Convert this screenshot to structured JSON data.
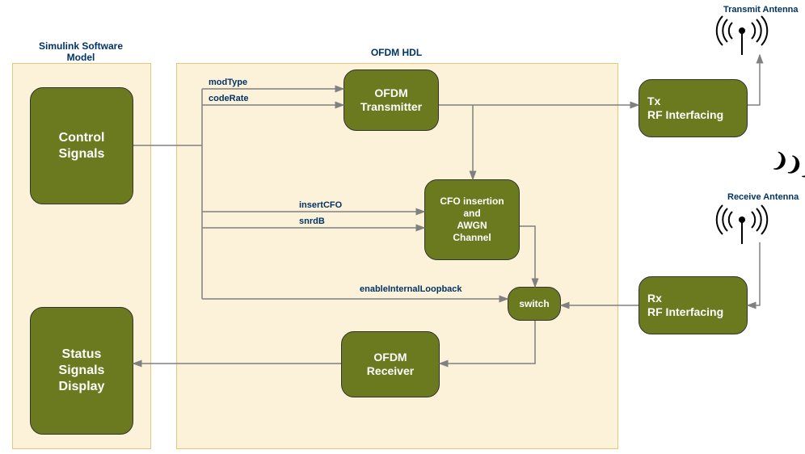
{
  "regions": {
    "simulink_label": "Simulink Software\nModel",
    "ofdm_hdl_label": "OFDM HDL"
  },
  "blocks": {
    "control_signals": "Control\nSignals",
    "status_display": "Status\nSignals\nDisplay",
    "ofdm_transmitter": "OFDM\nTransmitter",
    "cfo_awgn": "CFO insertion\nand\nAWGN\nChannel",
    "switch": "switch",
    "ofdm_receiver": "OFDM\nReceiver",
    "tx_rf": "Tx\nRF Interfacing",
    "rx_rf": "Rx\nRF Interfacing"
  },
  "signals": {
    "modType": "modType",
    "codeRate": "codeRate",
    "insertCFO": "insertCFO",
    "snrdB": "snrdB",
    "enableInternalLoopback": "enableInternalLoopback"
  },
  "antennas": {
    "transmit": "Transmit Antenna",
    "receive": "Receive Antenna"
  },
  "rf_waves": "❩❩❩",
  "chart_data": {
    "type": "block-diagram",
    "regions": [
      {
        "id": "simulink",
        "label": "Simulink Software Model",
        "contains": [
          "control_signals",
          "status_display"
        ]
      },
      {
        "id": "ofdm_hdl",
        "label": "OFDM HDL",
        "contains": [
          "ofdm_transmitter",
          "cfo_awgn",
          "switch",
          "ofdm_receiver"
        ]
      }
    ],
    "nodes": [
      {
        "id": "control_signals",
        "label": "Control Signals"
      },
      {
        "id": "status_display",
        "label": "Status Signals Display"
      },
      {
        "id": "ofdm_transmitter",
        "label": "OFDM Transmitter"
      },
      {
        "id": "cfo_awgn",
        "label": "CFO insertion and AWGN Channel"
      },
      {
        "id": "switch",
        "label": "switch"
      },
      {
        "id": "ofdm_receiver",
        "label": "OFDM Receiver"
      },
      {
        "id": "tx_rf",
        "label": "Tx RF Interfacing"
      },
      {
        "id": "rx_rf",
        "label": "Rx RF Interfacing"
      },
      {
        "id": "tx_antenna",
        "label": "Transmit Antenna"
      },
      {
        "id": "rx_antenna",
        "label": "Receive Antenna"
      }
    ],
    "edges": [
      {
        "from": "control_signals",
        "to": "ofdm_transmitter",
        "labels": [
          "modType",
          "codeRate"
        ]
      },
      {
        "from": "control_signals",
        "to": "cfo_awgn",
        "labels": [
          "insertCFO",
          "snrdB"
        ]
      },
      {
        "from": "control_signals",
        "to": "switch",
        "labels": [
          "enableInternalLoopback"
        ]
      },
      {
        "from": "ofdm_transmitter",
        "to": "tx_rf"
      },
      {
        "from": "ofdm_transmitter",
        "to": "cfo_awgn"
      },
      {
        "from": "cfo_awgn",
        "to": "switch"
      },
      {
        "from": "rx_rf",
        "to": "switch"
      },
      {
        "from": "switch",
        "to": "ofdm_receiver"
      },
      {
        "from": "ofdm_receiver",
        "to": "status_display"
      },
      {
        "from": "tx_rf",
        "to": "tx_antenna"
      },
      {
        "from": "rx_antenna",
        "to": "rx_rf"
      }
    ]
  }
}
